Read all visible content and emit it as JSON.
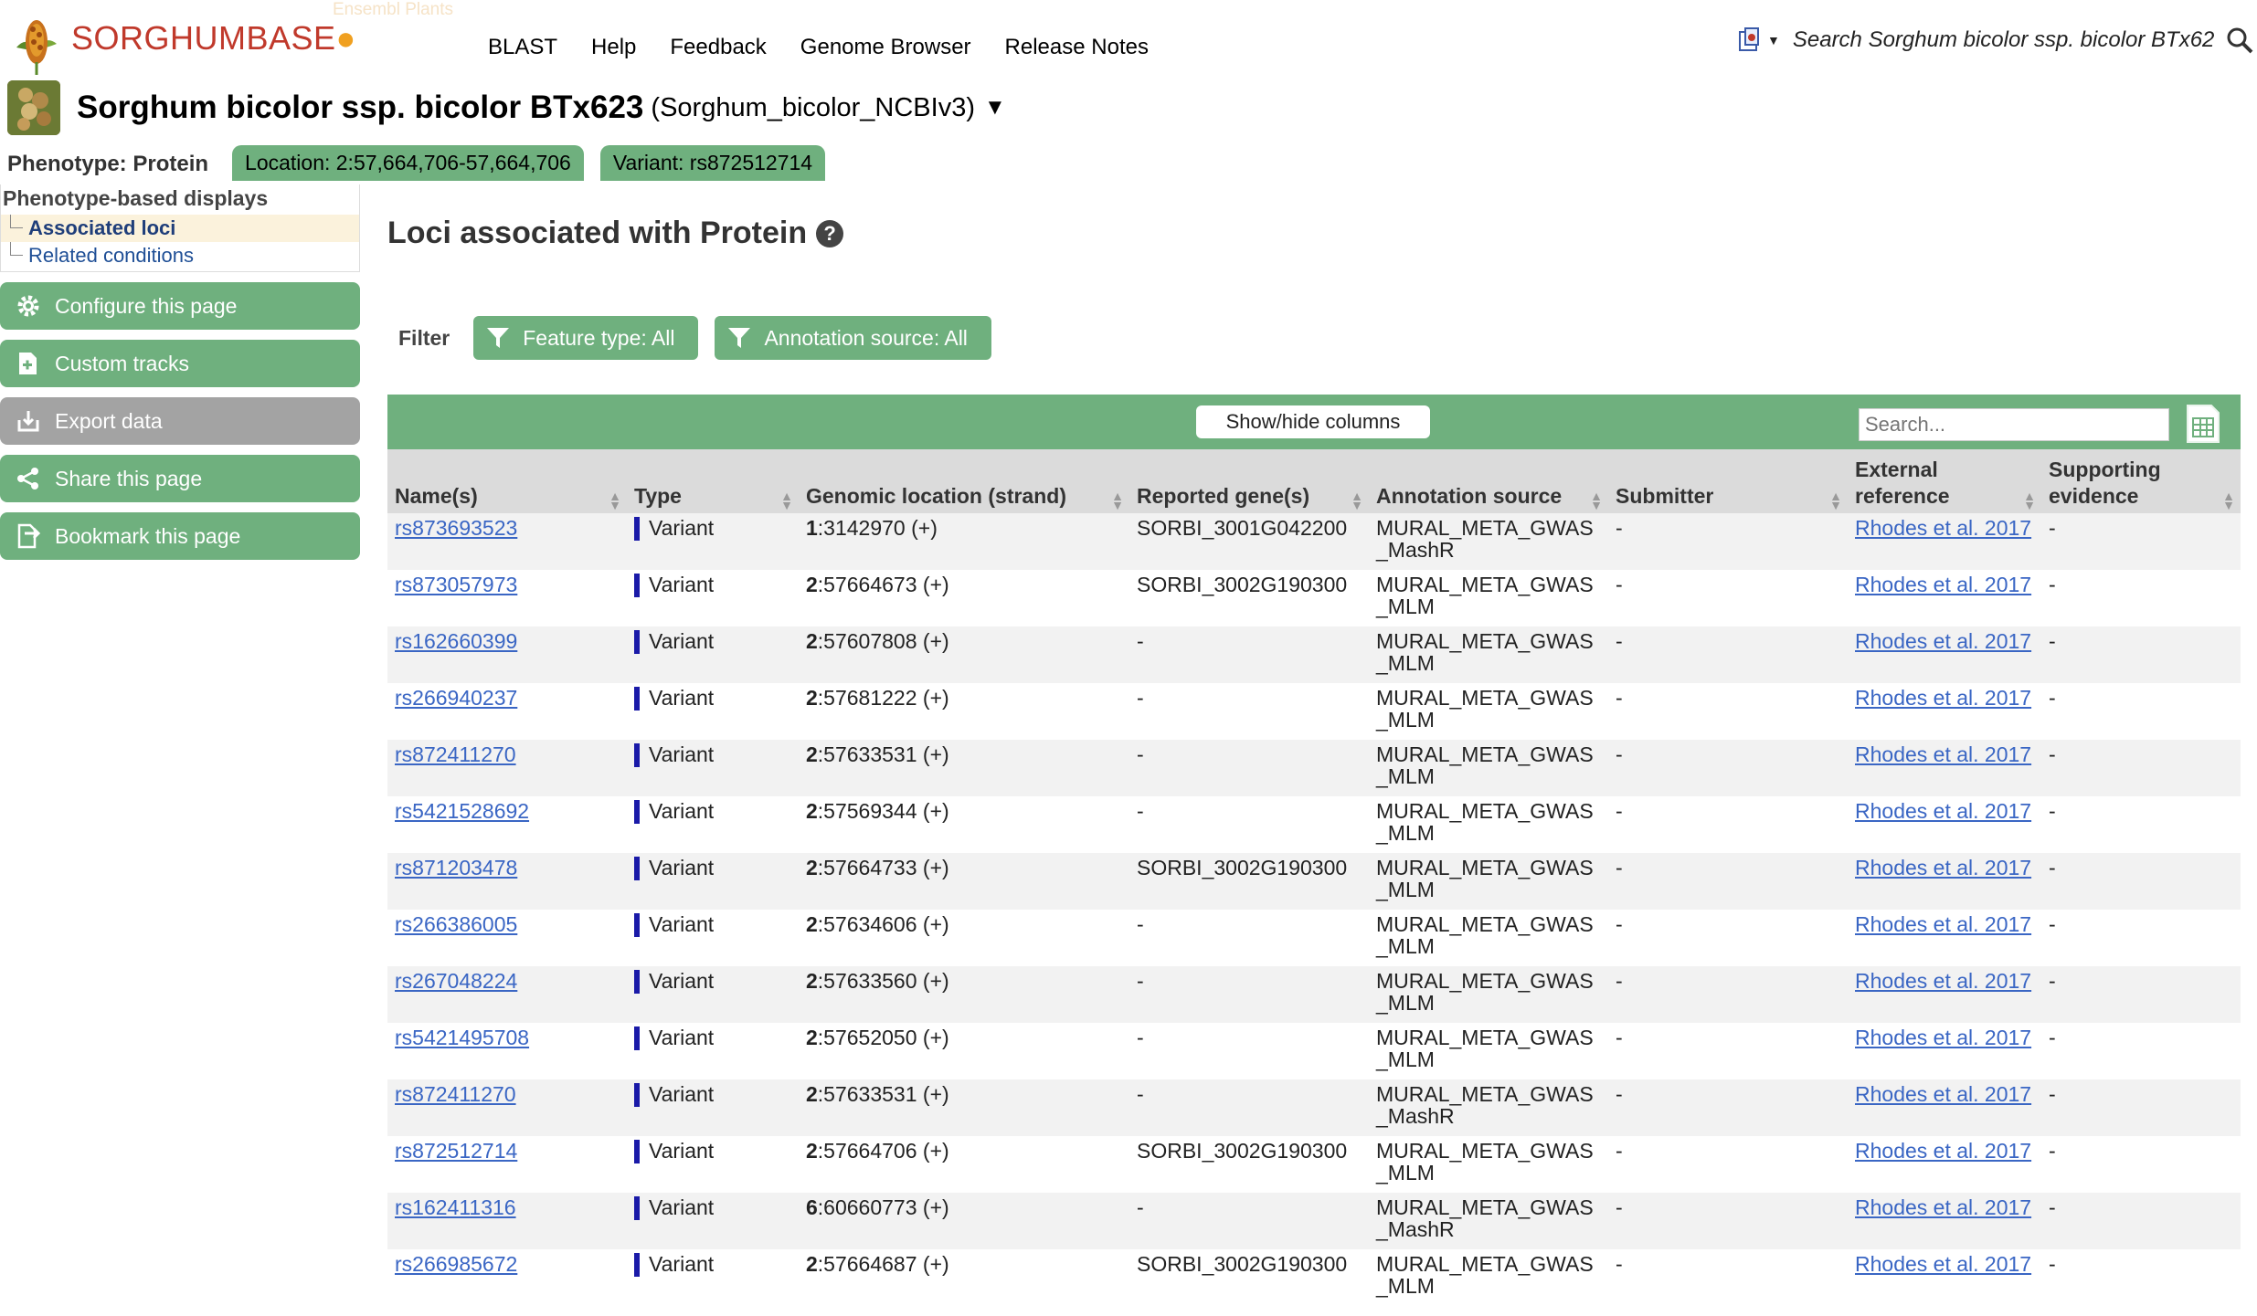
{
  "masthead": {
    "logo_text": "SORGHUMBASE",
    "logo_subtext": "Ensembl Plants",
    "nav": [
      "BLAST",
      "Help",
      "Feedback",
      "Genome Browser",
      "Release Notes"
    ],
    "search_text": "Search Sorghum bicolor ssp. bicolor BTx62"
  },
  "species": {
    "name": "Sorghum bicolor ssp. bicolor BTx623",
    "assembly": "(Sorghum_bicolor_NCBIv3)",
    "caret": "▼"
  },
  "tabs": {
    "phenotype": "Phenotype: Protein",
    "location": "Location: 2:57,664,706-57,664,706",
    "variant": "Variant: rs872512714"
  },
  "sidebar": {
    "title": "Phenotype-based displays",
    "items": [
      {
        "label": "Associated loci",
        "active": true
      },
      {
        "label": "Related conditions",
        "active": false
      }
    ],
    "buttons": [
      {
        "label": "Configure this page",
        "icon": "gear-icon"
      },
      {
        "label": "Custom tracks",
        "icon": "custom-tracks-icon"
      },
      {
        "label": "Export data",
        "icon": "export-icon"
      },
      {
        "label": "Share this page",
        "icon": "share-icon"
      },
      {
        "label": "Bookmark this page",
        "icon": "bookmark-icon"
      }
    ]
  },
  "main": {
    "title": "Loci associated with Protein",
    "help": "?"
  },
  "filter": {
    "label": "Filter",
    "feature_type": "Feature type: All",
    "annotation_source": "Annotation source: All"
  },
  "table": {
    "show_hide": "Show/hide columns",
    "search_placeholder": "Search...",
    "headers": [
      "Name(s)",
      "Type",
      "Genomic location (strand)",
      "Reported gene(s)",
      "Annotation source",
      "Submitter",
      "External reference",
      "Supporting evidence"
    ],
    "rows": [
      {
        "name": "rs873693523",
        "type": "Variant",
        "chr": "1",
        "loc": ":3142970 (+)",
        "gene": "SORBI_3001G042200",
        "source1": "MURAL_META_GWAS",
        "source2": "_MashR",
        "submitter": "-",
        "ref": "Rhodes et al. 2017",
        "evidence": "-"
      },
      {
        "name": "rs873057973",
        "type": "Variant",
        "chr": "2",
        "loc": ":57664673 (+)",
        "gene": "SORBI_3002G190300",
        "source1": "MURAL_META_GWAS",
        "source2": "_MLM",
        "submitter": "-",
        "ref": "Rhodes et al. 2017",
        "evidence": "-"
      },
      {
        "name": "rs162660399",
        "type": "Variant",
        "chr": "2",
        "loc": ":57607808 (+)",
        "gene": "-",
        "source1": "MURAL_META_GWAS",
        "source2": "_MLM",
        "submitter": "-",
        "ref": "Rhodes et al. 2017",
        "evidence": "-"
      },
      {
        "name": "rs266940237",
        "type": "Variant",
        "chr": "2",
        "loc": ":57681222 (+)",
        "gene": "-",
        "source1": "MURAL_META_GWAS",
        "source2": "_MLM",
        "submitter": "-",
        "ref": "Rhodes et al. 2017",
        "evidence": "-"
      },
      {
        "name": "rs872411270",
        "type": "Variant",
        "chr": "2",
        "loc": ":57633531 (+)",
        "gene": "-",
        "source1": "MURAL_META_GWAS",
        "source2": "_MLM",
        "submitter": "-",
        "ref": "Rhodes et al. 2017",
        "evidence": "-"
      },
      {
        "name": "rs5421528692",
        "type": "Variant",
        "chr": "2",
        "loc": ":57569344 (+)",
        "gene": "-",
        "source1": "MURAL_META_GWAS",
        "source2": "_MLM",
        "submitter": "-",
        "ref": "Rhodes et al. 2017",
        "evidence": "-"
      },
      {
        "name": "rs871203478",
        "type": "Variant",
        "chr": "2",
        "loc": ":57664733 (+)",
        "gene": "SORBI_3002G190300",
        "source1": "MURAL_META_GWAS",
        "source2": "_MLM",
        "submitter": "-",
        "ref": "Rhodes et al. 2017",
        "evidence": "-"
      },
      {
        "name": "rs266386005",
        "type": "Variant",
        "chr": "2",
        "loc": ":57634606 (+)",
        "gene": "-",
        "source1": "MURAL_META_GWAS",
        "source2": "_MLM",
        "submitter": "-",
        "ref": "Rhodes et al. 2017",
        "evidence": "-"
      },
      {
        "name": "rs267048224",
        "type": "Variant",
        "chr": "2",
        "loc": ":57633560 (+)",
        "gene": "-",
        "source1": "MURAL_META_GWAS",
        "source2": "_MLM",
        "submitter": "-",
        "ref": "Rhodes et al. 2017",
        "evidence": "-"
      },
      {
        "name": "rs5421495708",
        "type": "Variant",
        "chr": "2",
        "loc": ":57652050 (+)",
        "gene": "-",
        "source1": "MURAL_META_GWAS",
        "source2": "_MLM",
        "submitter": "-",
        "ref": "Rhodes et al. 2017",
        "evidence": "-"
      },
      {
        "name": "rs872411270",
        "type": "Variant",
        "chr": "2",
        "loc": ":57633531 (+)",
        "gene": "-",
        "source1": "MURAL_META_GWAS",
        "source2": "_MashR",
        "submitter": "-",
        "ref": "Rhodes et al. 2017",
        "evidence": "-"
      },
      {
        "name": "rs872512714",
        "type": "Variant",
        "chr": "2",
        "loc": ":57664706 (+)",
        "gene": "SORBI_3002G190300",
        "source1": "MURAL_META_GWAS",
        "source2": "_MLM",
        "submitter": "-",
        "ref": "Rhodes et al. 2017",
        "evidence": "-"
      },
      {
        "name": "rs162411316",
        "type": "Variant",
        "chr": "6",
        "loc": ":60660773 (+)",
        "gene": "-",
        "source1": "MURAL_META_GWAS",
        "source2": "_MashR",
        "submitter": "-",
        "ref": "Rhodes et al. 2017",
        "evidence": "-"
      },
      {
        "name": "rs266985672",
        "type": "Variant",
        "chr": "2",
        "loc": ":57664687 (+)",
        "gene": "SORBI_3002G190300",
        "source1": "MURAL_META_GWAS",
        "source2": "_MLM",
        "submitter": "-",
        "ref": "Rhodes et al. 2017",
        "evidence": "-"
      }
    ]
  },
  "colors": {
    "green": "#6fb07e",
    "link": "#3a66c4",
    "brand_red": "#c0392b",
    "variant_bar": "#1a1aa8"
  }
}
